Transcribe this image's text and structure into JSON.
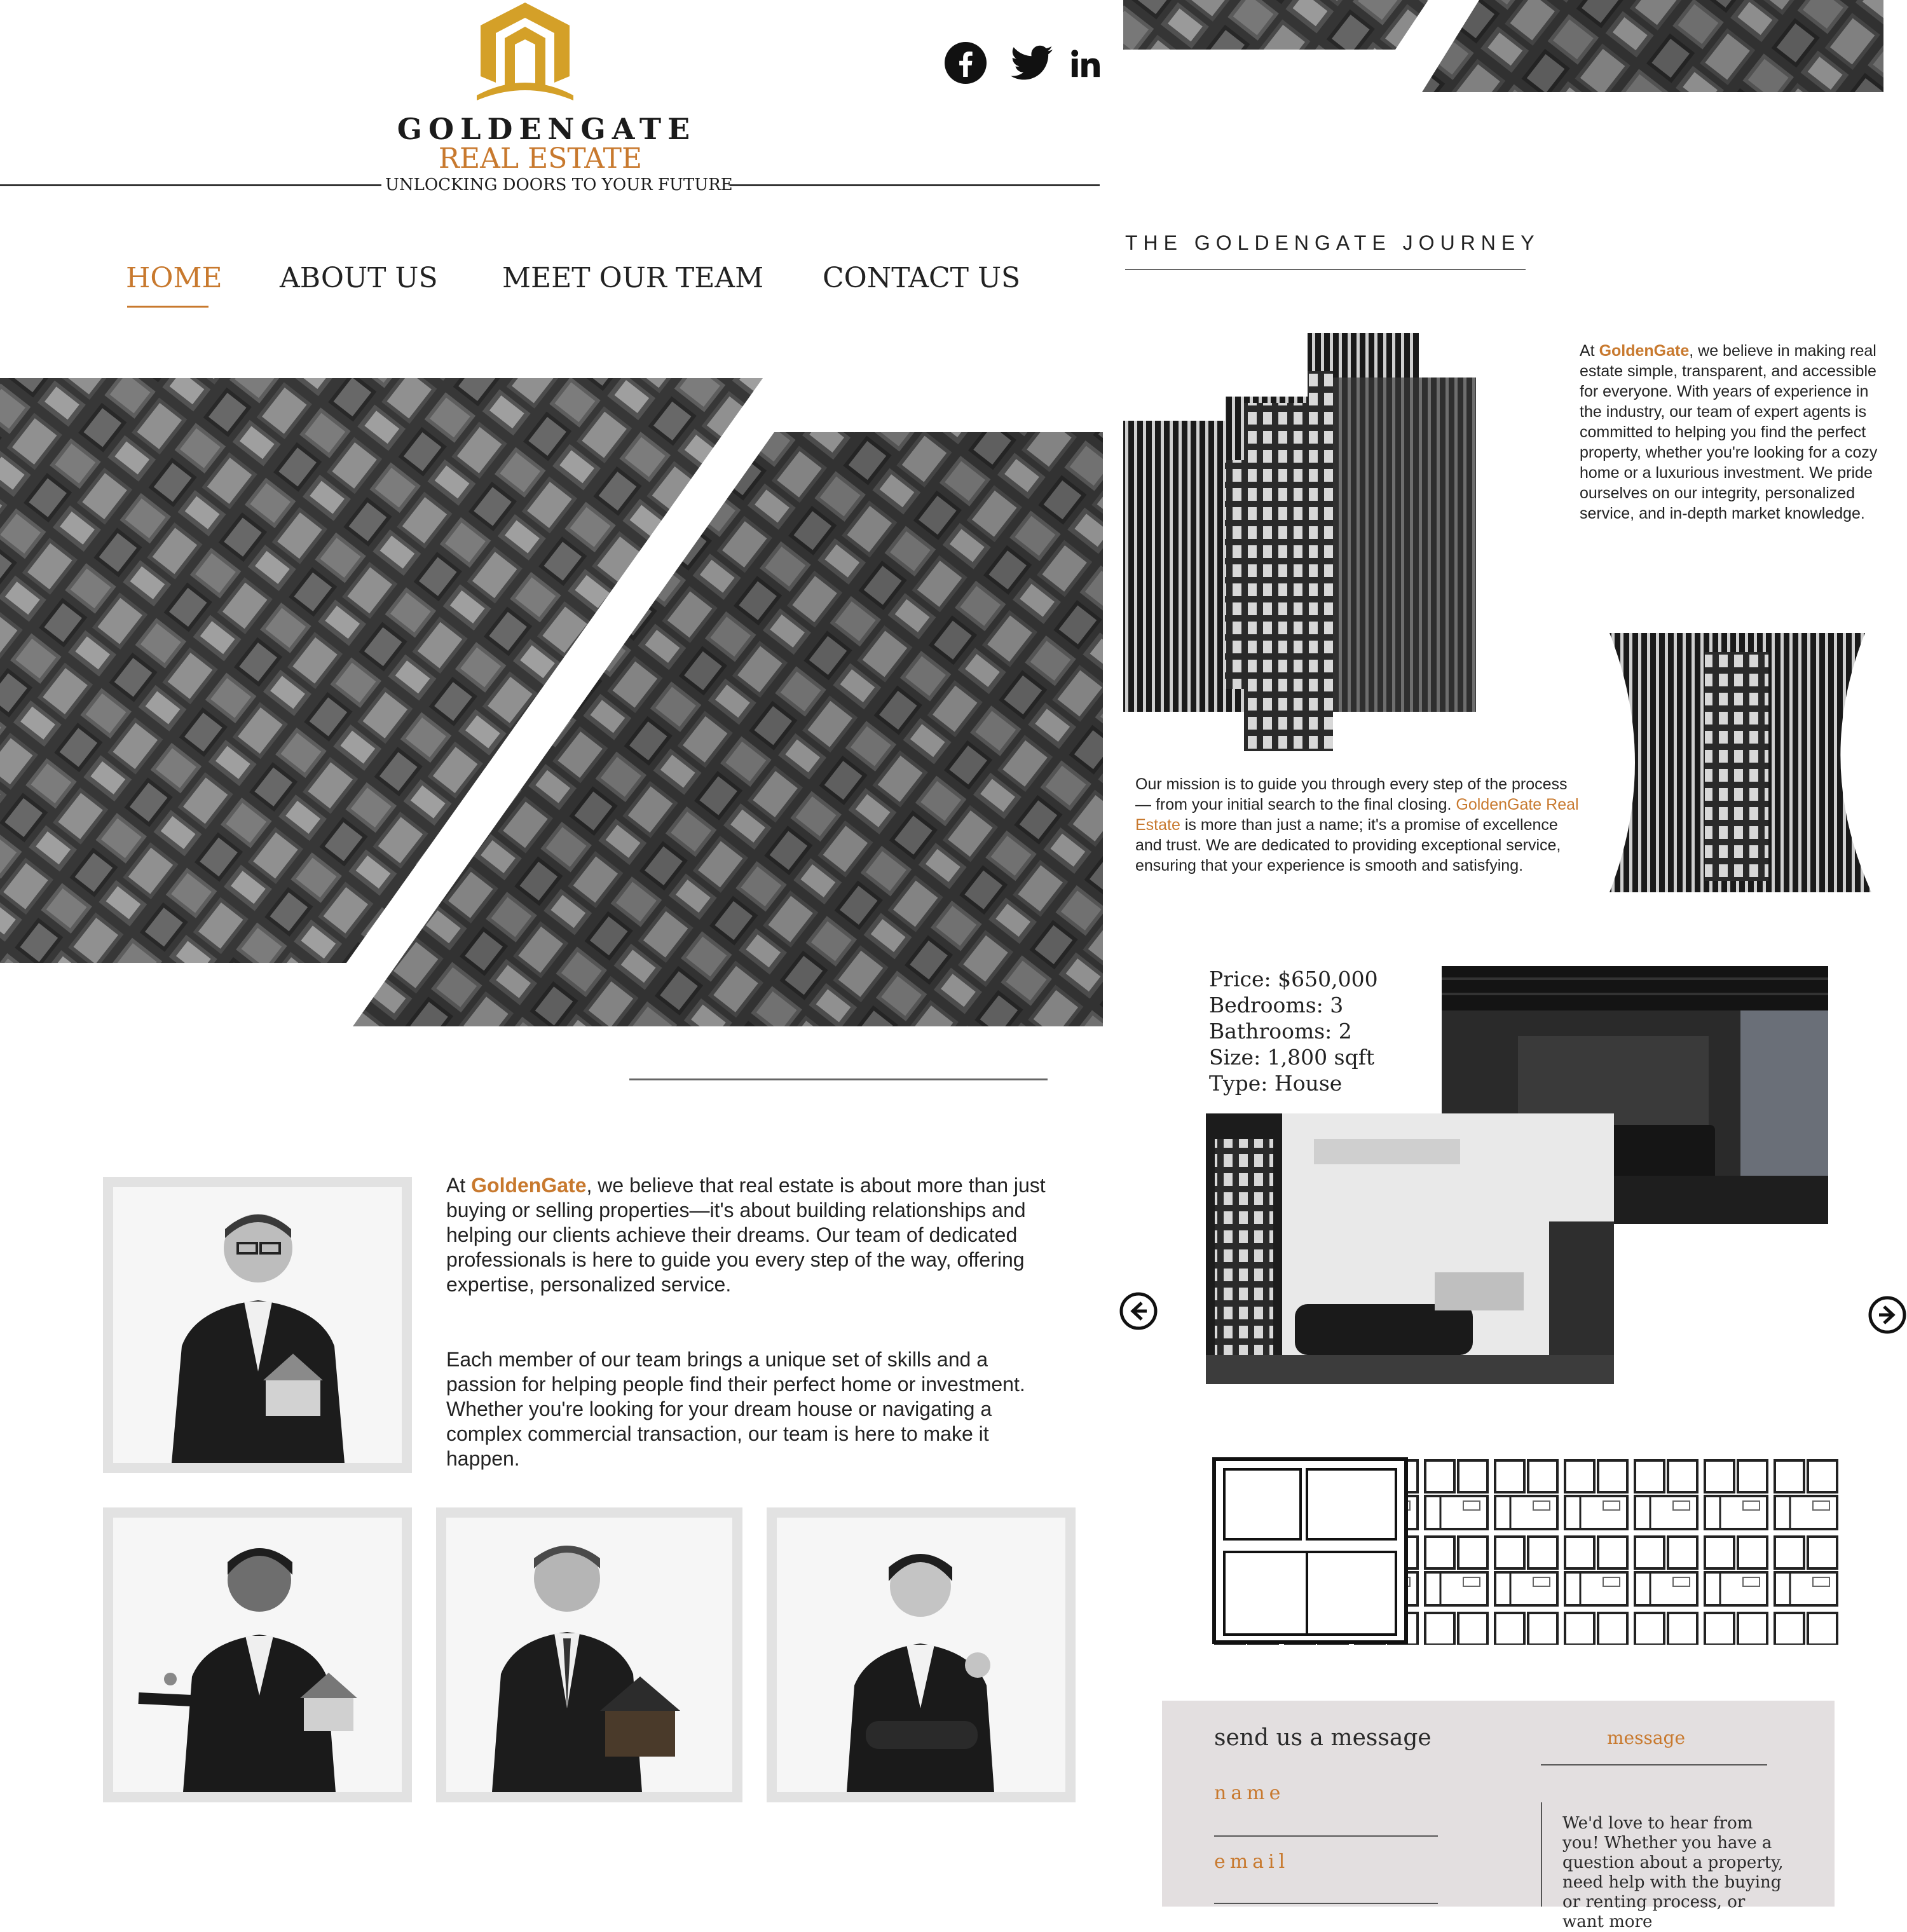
{
  "brand": {
    "name": "GOLDENGATE",
    "sub": "REAL ESTATE",
    "tagline": "UNLOCKING DOORS TO YOUR FUTURE"
  },
  "nav": {
    "items": [
      {
        "label": "HOME"
      },
      {
        "label": "ABOUT US"
      },
      {
        "label": "MEET OUR TEAM"
      },
      {
        "label": "CONTACT US"
      }
    ]
  },
  "social": [
    "facebook-icon",
    "twitter-icon",
    "linkedin-icon"
  ],
  "about": {
    "p1_prefix": "At ",
    "p1_brand": "GoldenGate",
    "p1_rest": ", we believe that real estate is about more than just buying or selling properties—it's about building relationships and helping our clients achieve their dreams. Our team of dedicated professionals is here to guide you every step of the way, offering expertise, personalized service.",
    "p2": "Each member of our team brings a unique set of skills and a passion for helping people find their perfect home or investment. Whether you're looking for your dream house or navigating a complex commercial transaction, our team is here to make it happen."
  },
  "journey": {
    "title": "THE GOLDENGATE JOURNEY",
    "p1_prefix": "At ",
    "p1_brand": "GoldenGate",
    "p1_rest": ", we believe in making real estate simple, transparent, and accessible for everyone. With years of experience in the industry, our team of expert agents is committed to helping you find the perfect property, whether you're looking for a cozy home or a luxurious investment. We pride ourselves on our integrity, personalized service, and in-depth market knowledge.",
    "p2_start": "Our mission is to guide you through every step of the process — from your initial search to the final closing. ",
    "p2_brand": "GoldenGate Real Estate",
    "p2_rest": " is more than just a name; it's a promise of excellence and trust. We are dedicated to providing exceptional service, ensuring that your experience is smooth and satisfying."
  },
  "listing": {
    "price": "Price: $650,000",
    "bedrooms": "Bedrooms: 3",
    "bathrooms": "Bathrooms: 2",
    "size": "Size: 1,800 sqft",
    "type": "Type: House"
  },
  "contact": {
    "heading": "send us a message",
    "name_label": "name",
    "email_label": "email",
    "message_tab": "message",
    "message_text": "We'd love to hear from you! Whether you have a question about a property, need help with the buying or renting process, or want more"
  },
  "colors": {
    "accent": "#c8792e",
    "logo_gold": "#d4a028",
    "form_bg": "#e3dfe0"
  }
}
